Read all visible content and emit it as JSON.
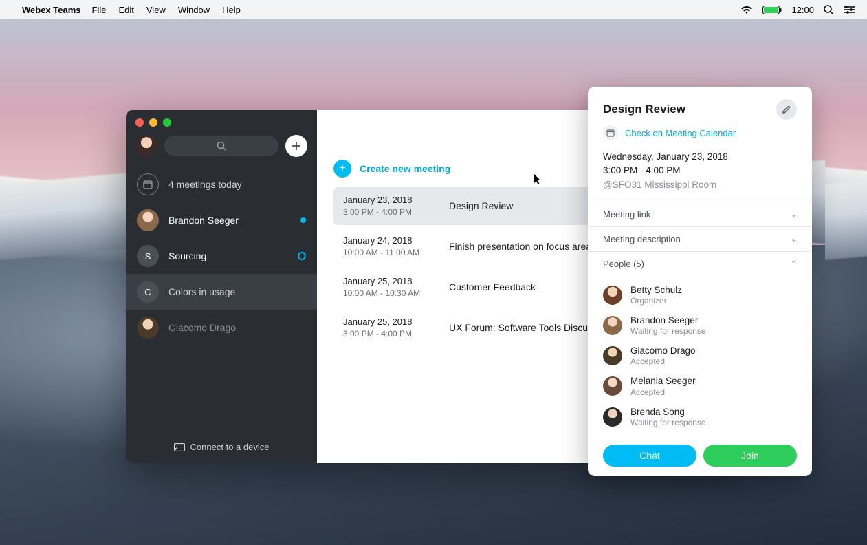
{
  "menubar": {
    "app": "Webex Teams",
    "items": [
      "File",
      "Edit",
      "View",
      "Window",
      "Help"
    ],
    "clock": "12:00"
  },
  "sidebar": {
    "meetings_today": "4 meetings today",
    "connect": "Connect to a device",
    "items": [
      {
        "label": "Brandon Seeger",
        "badge": "dot"
      },
      {
        "label": "Sourcing",
        "badge": "ring",
        "initial": "S"
      },
      {
        "label": "Colors in usage",
        "initial": "C",
        "selected": true
      },
      {
        "label": "Giacomo Drago"
      }
    ]
  },
  "header": {
    "space_label": "Colors in usage"
  },
  "create": {
    "label": "Create new meeting"
  },
  "meetings": [
    {
      "date": "January 23, 2018",
      "time": "3:00 PM - 4:00 PM",
      "title": "Design Review",
      "selected": true
    },
    {
      "date": "January 24, 2018",
      "time": "10:00 AM - 11:00 AM",
      "title": "Finish presentation on focus areas"
    },
    {
      "date": "January 25, 2018",
      "time": "10:00 AM - 10:30 AM",
      "title": "Customer Feedback"
    },
    {
      "date": "January 25, 2018",
      "time": "3:00 PM - 4:00 PM",
      "title": "UX Forum: Software Tools Discussion"
    }
  ],
  "detail": {
    "title": "Design Review",
    "calendar_link": "Check on Meeting Calendar",
    "date": "Wednesday, January 23, 2018",
    "time": "3:00 PM - 4:00 PM",
    "room": "@SFO31 Mississippi Room",
    "sections": {
      "link": "Meeting link",
      "description": "Meeting description",
      "people": "People (5)"
    },
    "people": [
      {
        "name": "Betty Schulz",
        "status": "Organizer"
      },
      {
        "name": "Brandon Seeger",
        "status": "Waiting for response"
      },
      {
        "name": "Giacomo Drago",
        "status": "Accepted"
      },
      {
        "name": "Melania Seeger",
        "status": "Accepted"
      },
      {
        "name": "Brenda Song",
        "status": "Waiting for response"
      }
    ],
    "chat": "Chat",
    "join": "Join"
  }
}
